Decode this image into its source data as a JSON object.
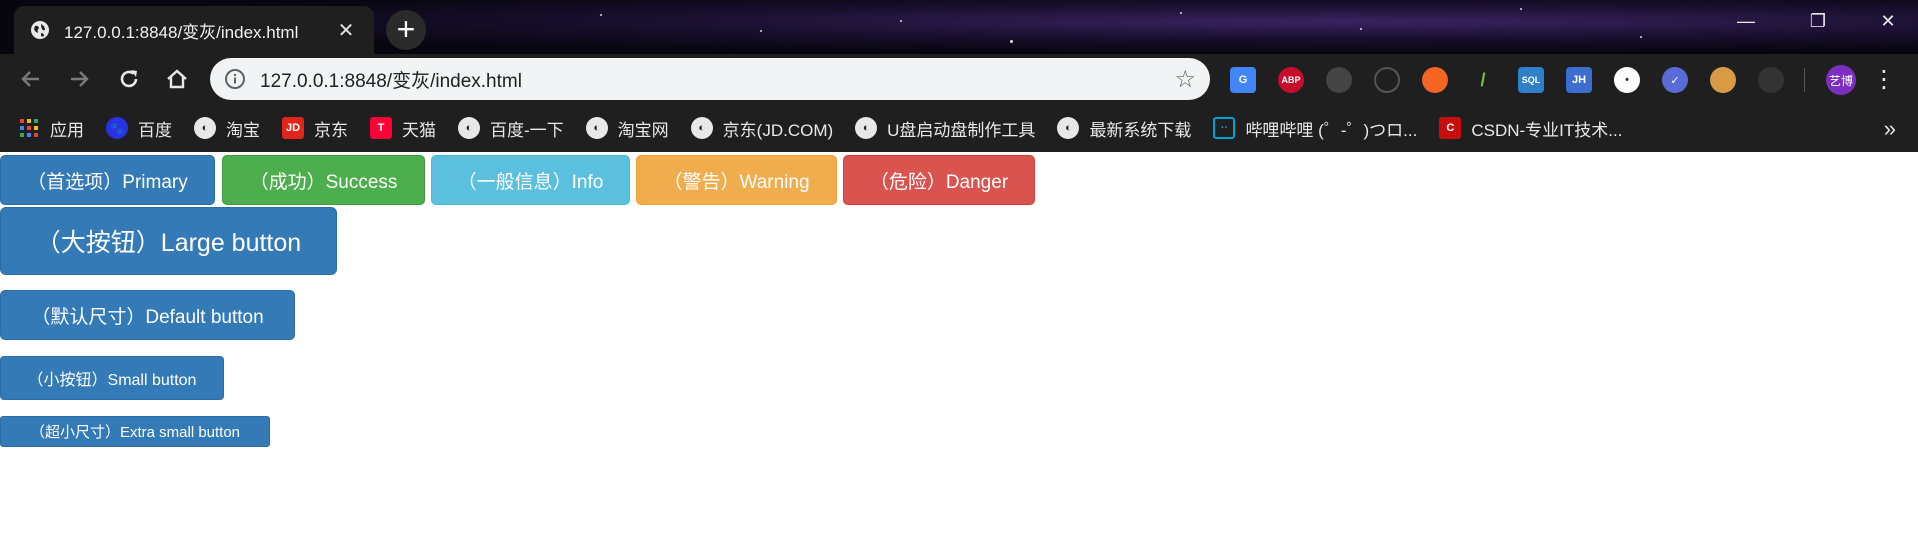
{
  "browser": {
    "tab": {
      "title": "127.0.0.1:8848/变灰/index.html",
      "favicon": "globe-icon",
      "close_glyph": "✕"
    },
    "new_tab_glyph": "+",
    "window_controls": {
      "minimize": "—",
      "restore": "❐",
      "close": "✕"
    },
    "address_bar": {
      "url": "127.0.0.1:8848/变灰/index.html"
    },
    "extensions": [
      {
        "name": "google-translate-icon",
        "label": "G",
        "color": "#4285f4"
      },
      {
        "name": "adblock-plus-icon",
        "label": "ABP",
        "color": "#c70d2c"
      },
      {
        "name": "extension-shield-icon",
        "label": "",
        "color": "#444444"
      },
      {
        "name": "extension-ring-icon",
        "label": "",
        "color": "#2a2a2a"
      },
      {
        "name": "extension-orange-icon",
        "label": "",
        "color": "#f46524"
      },
      {
        "name": "devtools-icon",
        "label": "/",
        "color": "#2a2a2a"
      },
      {
        "name": "sql-icon",
        "label": "SQL",
        "color": "#2f80c8"
      },
      {
        "name": "jh-icon",
        "label": "JH",
        "color": "#3b6ecf"
      },
      {
        "name": "extension-dots-icon",
        "label": "",
        "color": "#ffffff"
      },
      {
        "name": "extension-check-icon",
        "label": "✓",
        "color": "#5a6bd8"
      },
      {
        "name": "cookie-icon",
        "label": "",
        "color": "#d99a45"
      },
      {
        "name": "extension-dim-icon",
        "label": "",
        "color": "#333333"
      }
    ],
    "avatar_label": "艺博",
    "bookmarks": [
      {
        "label": "应用",
        "icon": "apps-grid-icon",
        "color": "#ea4335"
      },
      {
        "label": "百度",
        "icon": "baidu-paw-icon",
        "color": "#2932e1"
      },
      {
        "label": "淘宝",
        "icon": "globe-icon",
        "color": ""
      },
      {
        "label": "京东",
        "icon": "jd-icon",
        "color": "#e1251b"
      },
      {
        "label": "天猫",
        "icon": "tmall-icon",
        "color": "#ff0036"
      },
      {
        "label": "百度-一下",
        "icon": "globe-icon",
        "color": ""
      },
      {
        "label": "淘宝网",
        "icon": "globe-icon",
        "color": ""
      },
      {
        "label": "京东(JD.COM)",
        "icon": "globe-icon",
        "color": ""
      },
      {
        "label": "U盘启动盘制作工具",
        "icon": "globe-icon",
        "color": ""
      },
      {
        "label": "最新系统下载",
        "icon": "globe-icon",
        "color": ""
      },
      {
        "label": "哔哩哔哩 (゜-゜)つロ...",
        "icon": "bilibili-icon",
        "color": "#00a1d6"
      },
      {
        "label": "CSDN-专业IT技术...",
        "icon": "csdn-icon",
        "color": "#c90c0c"
      }
    ],
    "bookmarks_overflow_glyph": "»"
  },
  "page": {
    "buttons": {
      "primary": "（首选项）Primary",
      "success": "（成功）Success",
      "info": "（一般信息）Info",
      "warning": "（警告）Warning",
      "danger": "（危险）Danger",
      "large": "（大按钮）Large button",
      "default": "（默认尺寸）Default button",
      "small": "（小按钮）Small button",
      "xsmall": "（超小尺寸）Extra small button"
    }
  }
}
